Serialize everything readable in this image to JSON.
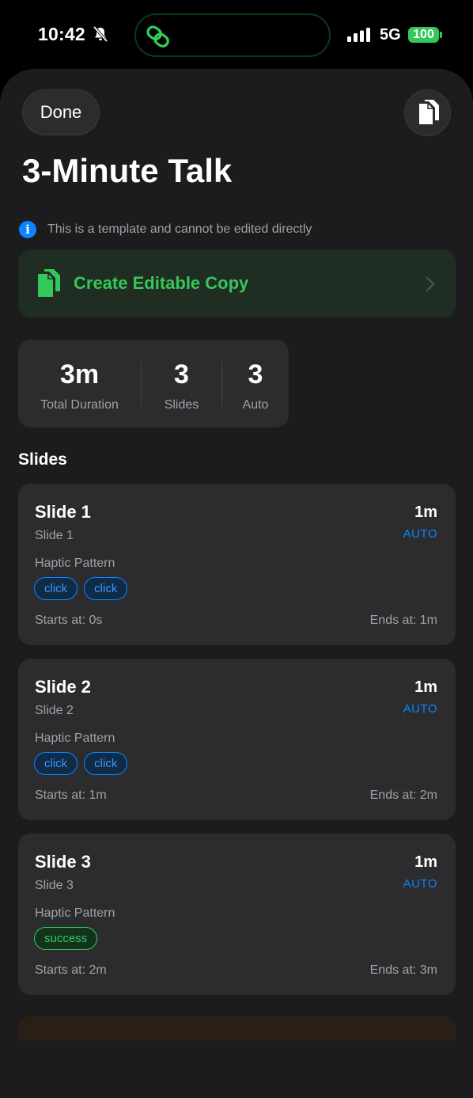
{
  "status_bar": {
    "time": "10:42",
    "network": "5G",
    "battery": "100",
    "colors": {
      "battery": "#34c759",
      "island_icon": "#30d158"
    }
  },
  "header": {
    "done_label": "Done",
    "title": "3-Minute Talk"
  },
  "notice": {
    "text": "This is a template and cannot be edited directly",
    "icon": "info-icon",
    "color": "#0a84ff"
  },
  "create_copy": {
    "label": "Create Editable Copy",
    "icon": "documents-icon",
    "color": "#34c759"
  },
  "stats": [
    {
      "value": "3m",
      "label": "Total Duration"
    },
    {
      "value": "3",
      "label": "Slides"
    },
    {
      "value": "3",
      "label": "Auto"
    }
  ],
  "section_title": "Slides",
  "slides": [
    {
      "title": "Slide 1",
      "subtitle": "Slide 1",
      "duration": "1m",
      "mode": "AUTO",
      "haptic_label": "Haptic Pattern",
      "tags": [
        "click",
        "click"
      ],
      "starts": "Starts at: 0s",
      "ends": "Ends at: 1m"
    },
    {
      "title": "Slide 2",
      "subtitle": "Slide 2",
      "duration": "1m",
      "mode": "AUTO",
      "haptic_label": "Haptic Pattern",
      "tags": [
        "click",
        "click"
      ],
      "starts": "Starts at: 1m",
      "ends": "Ends at: 2m"
    },
    {
      "title": "Slide 3",
      "subtitle": "Slide 3",
      "duration": "1m",
      "mode": "AUTO",
      "haptic_label": "Haptic Pattern",
      "tags": [
        "success"
      ],
      "starts": "Starts at: 2m",
      "ends": "Ends at: 3m"
    }
  ]
}
